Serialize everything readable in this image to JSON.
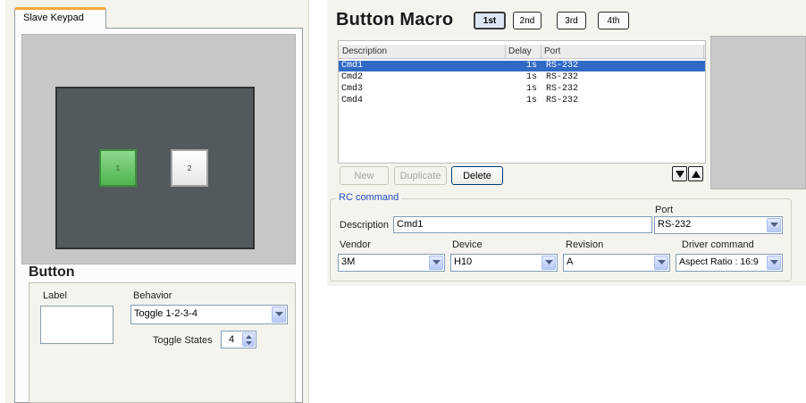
{
  "keypad": {
    "tab_label": "Slave Keypad",
    "keys": [
      {
        "label": "1",
        "state": "active",
        "color": "#5cbf5c"
      },
      {
        "label": "2",
        "state": "inactive",
        "color": "#f0f0f0"
      }
    ]
  },
  "button_panel": {
    "title": "Button",
    "label_caption": "Label",
    "label_value": "",
    "behavior_caption": "Behavior",
    "behavior_value": "Toggle 1-2-3-4",
    "toggle_states_caption": "Toggle States",
    "toggle_states_value": "4"
  },
  "macro": {
    "title": "Button Macro",
    "order_tabs": [
      {
        "label": "1st",
        "active": true
      },
      {
        "label": "2nd",
        "active": false
      },
      {
        "label": "3rd",
        "active": false
      },
      {
        "label": "4th",
        "active": false
      }
    ],
    "columns": [
      "Description",
      "Delay",
      "Port"
    ],
    "rows": [
      {
        "description": "Cmd1",
        "delay": "1s",
        "port": "RS-232",
        "selected": true
      },
      {
        "description": "Cmd2",
        "delay": "1s",
        "port": "RS-232",
        "selected": false
      },
      {
        "description": "Cmd3",
        "delay": "1s",
        "port": "RS-232",
        "selected": false
      },
      {
        "description": "Cmd4",
        "delay": "1s",
        "port": "RS-232",
        "selected": false
      }
    ],
    "buttons": {
      "new_label": "New",
      "duplicate_label": "Duplicate",
      "delete_label": "Delete"
    },
    "move_down_icon": "triangle-down-icon",
    "move_up_icon": "triangle-up-icon"
  },
  "rc_command": {
    "legend": "RC command",
    "description_caption": "Description",
    "description_value": "Cmd1",
    "port_caption": "Port",
    "port_value": "RS-232",
    "vendor_caption": "Vendor",
    "vendor_value": "3M",
    "device_caption": "Device",
    "device_value": "H10",
    "revision_caption": "Revision",
    "revision_value": "A",
    "driver_caption": "Driver command",
    "driver_value": "Aspect Ratio : 16:9"
  },
  "colors": {
    "accent_tab": "#f7a739",
    "selection": "#316ac5",
    "legend_text": "#1f4fbf"
  }
}
